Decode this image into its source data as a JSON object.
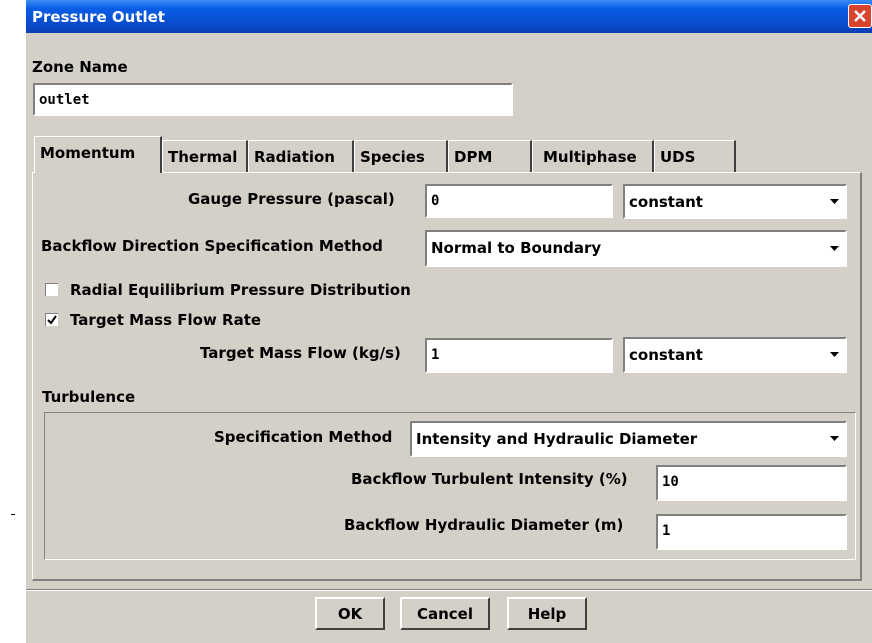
{
  "window": {
    "title": "Pressure Outlet"
  },
  "zone": {
    "label": "Zone Name",
    "value": "outlet"
  },
  "tabs": [
    {
      "label": "Momentum"
    },
    {
      "label": "Thermal"
    },
    {
      "label": "Radiation"
    },
    {
      "label": "Species"
    },
    {
      "label": "DPM"
    },
    {
      "label": "Multiphase"
    },
    {
      "label": "UDS"
    }
  ],
  "momentum": {
    "gauge_pressure": {
      "label": "Gauge Pressure (pascal)",
      "value": "0",
      "mode": "constant"
    },
    "backflow_direction": {
      "label": "Backflow Direction Specification Method",
      "value": "Normal to Boundary"
    },
    "radial_equilibrium": {
      "label": "Radial Equilibrium Pressure Distribution",
      "checked": false
    },
    "target_mass_flow_rate": {
      "label": "Target Mass Flow Rate",
      "checked": true
    },
    "target_mass_flow": {
      "label": "Target Mass Flow (kg/s)",
      "value": "1",
      "mode": "constant"
    }
  },
  "turbulence": {
    "heading": "Turbulence",
    "specification_method": {
      "label": "Specification Method",
      "value": "Intensity and Hydraulic Diameter"
    },
    "intensity": {
      "label": "Backflow Turbulent Intensity (%)",
      "value": "10"
    },
    "diameter": {
      "label": "Backflow Hydraulic Diameter (m)",
      "value": "1"
    }
  },
  "buttons": {
    "ok": "OK",
    "cancel": "Cancel",
    "help": "Help"
  },
  "colors": {
    "titlebar": "#0a5ee6",
    "close": "#d8442e",
    "dialog_bg": "#d4d0c8"
  }
}
